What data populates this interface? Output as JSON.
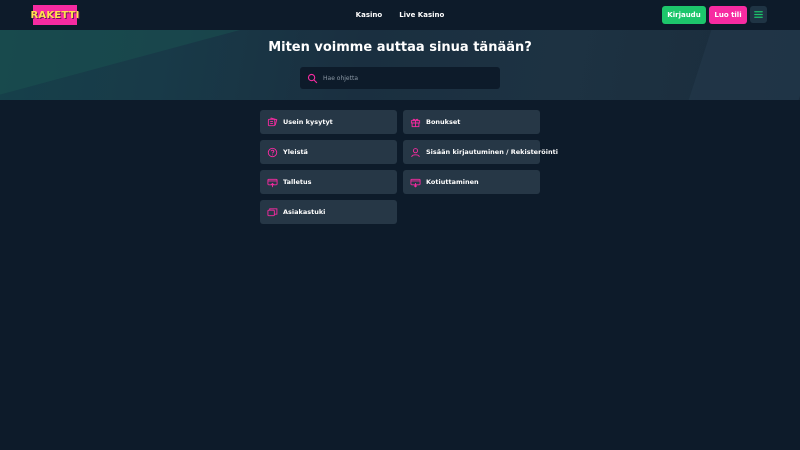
{
  "header": {
    "logo_text": "RAKETTI",
    "nav": [
      {
        "label": "Kasino"
      },
      {
        "label": "Live Kasino"
      }
    ],
    "login_label": "Kirjaudu",
    "register_label": "Luo tili"
  },
  "hero": {
    "title": "Miten voimme auttaa sinua tänään?",
    "search_placeholder": "Hae ohjetta"
  },
  "categories": [
    {
      "label": "Usein kysytyt",
      "icon": "faq-icon"
    },
    {
      "label": "Bonukset",
      "icon": "gift-icon"
    },
    {
      "label": "Yleistä",
      "icon": "question-icon"
    },
    {
      "label": "Sisään kirjautuminen / Rekisteröinti",
      "icon": "user-icon"
    },
    {
      "label": "Talletus",
      "icon": "deposit-icon"
    },
    {
      "label": "Kotiuttaminen",
      "icon": "withdraw-icon"
    },
    {
      "label": "Asiakastuki",
      "icon": "support-icon"
    }
  ],
  "colors": {
    "background": "#0d1b2a",
    "card": "#263746",
    "accent_pink": "#f72ba1",
    "accent_green": "#1dc66b",
    "logo_text": "#ffe14d"
  }
}
